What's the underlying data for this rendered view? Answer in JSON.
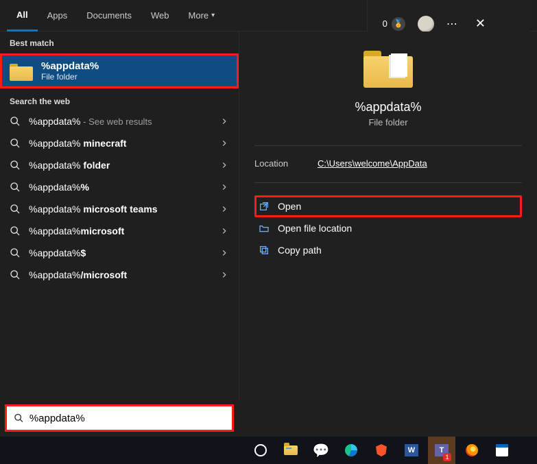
{
  "tabs": {
    "all": "All",
    "apps": "Apps",
    "documents": "Documents",
    "web": "Web",
    "more": "More"
  },
  "header": {
    "points": "0"
  },
  "sections": {
    "best_match": "Best match",
    "search_web": "Search the web"
  },
  "best": {
    "title": "%appdata%",
    "subtitle": "File folder"
  },
  "web": [
    {
      "prefix": "%appdata%",
      "bold": "",
      "suffix": " - See web results"
    },
    {
      "prefix": "%appdata% ",
      "bold": "minecraft",
      "suffix": ""
    },
    {
      "prefix": "%appdata% ",
      "bold": "folder",
      "suffix": ""
    },
    {
      "prefix": "%appdata%",
      "bold": "%",
      "suffix": ""
    },
    {
      "prefix": "%appdata% ",
      "bold": "microsoft teams",
      "suffix": ""
    },
    {
      "prefix": "%appdata%",
      "bold": "microsoft",
      "suffix": ""
    },
    {
      "prefix": "%appdata%",
      "bold": "$",
      "suffix": ""
    },
    {
      "prefix": "%appdata%",
      "bold": "/microsoft",
      "suffix": ""
    }
  ],
  "preview": {
    "title": "%appdata%",
    "subtitle": "File folder",
    "location_label": "Location",
    "location_value": "C:\\Users\\welcome\\AppData",
    "actions": {
      "open": "Open",
      "open_loc": "Open file location",
      "copy_path": "Copy path"
    }
  },
  "search": {
    "value": "%appdata%"
  },
  "taskbar": {
    "word": "W",
    "teams": "T",
    "teams_badge": "1"
  }
}
